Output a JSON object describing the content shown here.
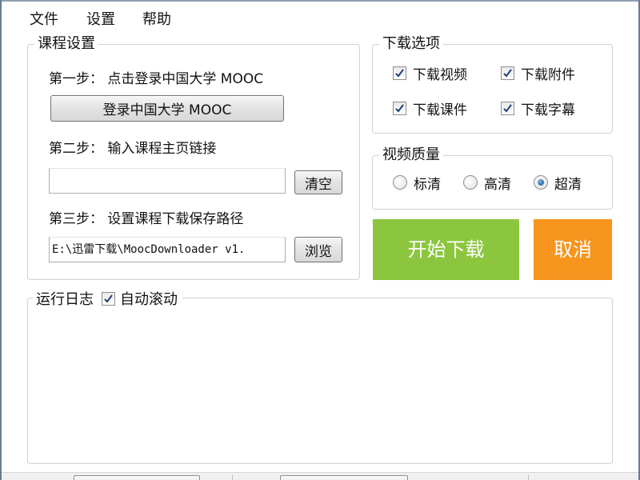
{
  "menu": [
    "文件",
    "设置",
    "帮助"
  ],
  "course": {
    "title": "课程设置",
    "step1": "第一步： 点击登录中国大学 MOOC",
    "login_button": "登录中国大学 MOOC",
    "step2": "第二步： 输入课程主页链接",
    "url_value": "",
    "clear_button": "清空",
    "step3": "第三步： 设置课程下载保存路径",
    "path_value": "E:\\迅雷下载\\MoocDownloader v1.",
    "browse_button": "浏览"
  },
  "download_options": {
    "title": "下载选项",
    "items": [
      {
        "label": "下载视频",
        "checked": true
      },
      {
        "label": "下载附件",
        "checked": true
      },
      {
        "label": "下载课件",
        "checked": true
      },
      {
        "label": "下载字幕",
        "checked": true
      }
    ]
  },
  "video_quality": {
    "title": "视频质量",
    "options": [
      {
        "label": "标清",
        "selected": false
      },
      {
        "label": "高清",
        "selected": false
      },
      {
        "label": "超清",
        "selected": true
      }
    ]
  },
  "actions": {
    "start_label": "开始下载",
    "start_color": "#8cc63f",
    "cancel_label": "取消",
    "cancel_color": "#f7941d"
  },
  "log": {
    "title": "运行日志",
    "autoscroll_label": "自动滚动",
    "autoscroll_checked": true,
    "content": ""
  },
  "colors": {
    "group_border": "#c8d3dd",
    "check_mark": "#1f3f7a"
  }
}
